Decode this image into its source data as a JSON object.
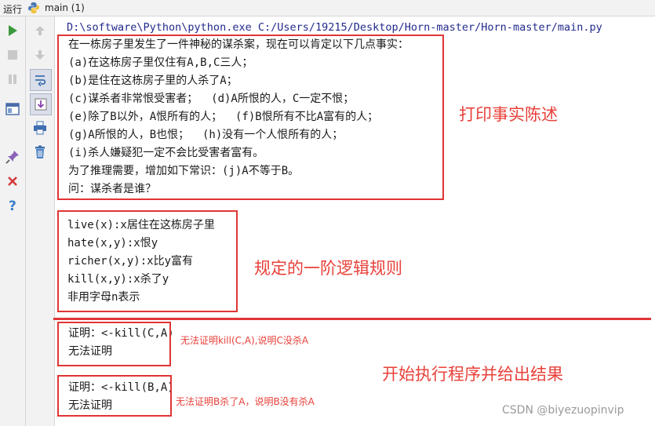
{
  "titlebar": {
    "run_label": "运行",
    "tab_label": "main (1)"
  },
  "console": {
    "command": "D:\\software\\Python\\python.exe C:/Users/19215/Desktop/Horn-master/Horn-master/main.py",
    "facts": [
      "在一栋房子里发生了一件神秘的谋杀案，现在可以肯定以下几点事实：",
      "(a)在这栋房子里仅住有A,B,C三人；",
      "(b)是住在这栋房子里的人杀了A；",
      "(c)谋杀者非常恨受害者；  (d)A所恨的人，C一定不恨；",
      "(e)除了B以外，A恨所有的人；  (f)B恨所有不比A富有的人；",
      "(g)A所恨的人，B也恨；  (h)没有一个人恨所有的人；",
      "(i)杀人嫌疑犯一定不会比受害者富有。",
      "为了推理需要，增加如下常识：(j)A不等于B。",
      "问：谋杀者是谁？"
    ],
    "rules": [
      "live(x):x居住在这栋房子里",
      "hate(x,y):x恨y",
      "richer(x,y):x比y富有",
      "kill(x,y):x杀了y",
      "非用字母n表示"
    ],
    "proof1": [
      "证明：<-kill(C,A)",
      "无法证明"
    ],
    "proof2": [
      "证明：<-kill(B,A)",
      "无法证明"
    ]
  },
  "annotations": {
    "facts_label": "打印事实陈述",
    "rules_label": "规定的一阶逻辑规则",
    "result_label": "开始执行程序并给出结果",
    "proof1_note": "无法证明kill(C,A),说明C没杀A",
    "proof2_note": "无法证明B杀了A，说明B没有杀A"
  },
  "watermark": "CSDN @biyezuopinvip",
  "colors": {
    "annotation": "#e8413a",
    "run_green": "#3c9a3c",
    "stop_red": "#d33b3b",
    "path_blue": "#222a8c"
  }
}
